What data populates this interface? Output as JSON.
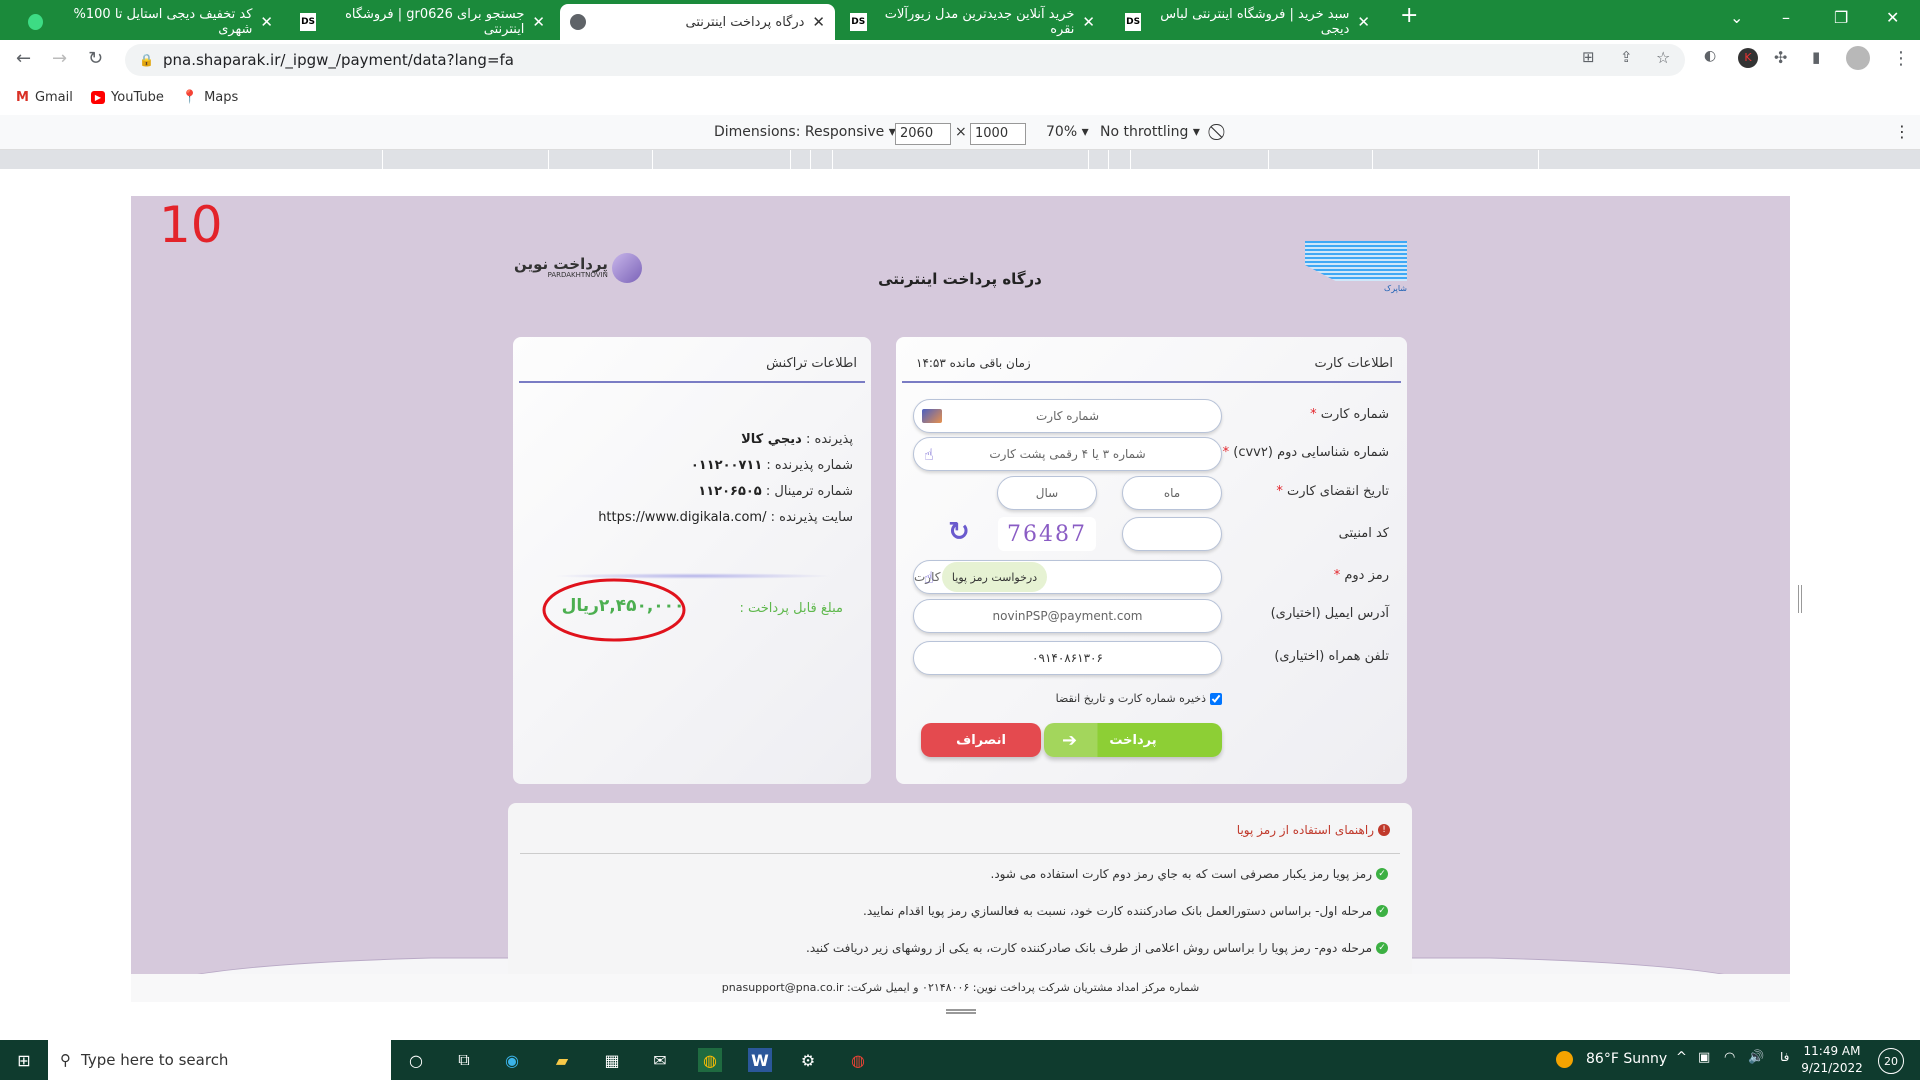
{
  "browser": {
    "tabs": [
      {
        "title": "کد تخفیف دیجی استایل تا 100% شهری",
        "active": false
      },
      {
        "title": "جستجو برای gr0626 | فروشگاه اینترنتی",
        "active": false,
        "favicon": "DS"
      },
      {
        "title": "درگاه پرداخت اینترنتی",
        "active": true
      },
      {
        "title": "خرید آنلاین جدیدترین مدل زیورآلات نقره",
        "active": false,
        "favicon": "DS"
      },
      {
        "title": "سبد خرید | فروشگاه اینترنتی لباس دیجی",
        "active": false,
        "favicon": "DS"
      }
    ],
    "url": "pna.shaparak.ir/_ipgw_/payment/data?lang=fa",
    "bookmarks": [
      "Gmail",
      "YouTube",
      "Maps"
    ],
    "accent": "#1b8a3b"
  },
  "devtools": {
    "dimensions": "Dimensions: Responsive",
    "width": "2060",
    "times": "×",
    "height": "1000",
    "zoom": "70%",
    "throttling": "No throttling"
  },
  "annotation": {
    "number": "10"
  },
  "header": {
    "title": "درگاه پرداخت اینترنتی",
    "logo_left": "پرداخت نوین PARDAKHTNOVIN",
    "logo_right": "شاپرک"
  },
  "card_form": {
    "title": "اطلاعات کارت",
    "timer": "زمان باقی مانده ۱۴:۵۳",
    "labels": {
      "card_number": "شماره کارت",
      "cvv2": "شماره شناسایی دوم (cvv۲)",
      "expiry": "تاریخ انقضای کارت",
      "captcha": "کد امنیتی",
      "pin2": "رمز دوم",
      "email": "آدرس ایمیل (اختیاری)",
      "phone": "تلفن همراه (اختیاری)"
    },
    "placeholders": {
      "card_number": "شماره کارت",
      "cvv2": "شماره ۳ یا ۴ رقمی پشت کارت",
      "month": "ماه",
      "year": "سال",
      "pin2": "رمز دوم کارت"
    },
    "values": {
      "email": "novinPSP@payment.com",
      "phone": "۰۹۱۴۰۸۶۱۳۰۶",
      "captcha_image": "76487"
    },
    "dynamic_pin_button": "درخواست رمز پویا",
    "save_checkbox": "ذخیره شماره کارت و تاریخ انقضا",
    "save_checked": true,
    "pay_button": "پرداخت",
    "cancel_button": "انصراف",
    "required": "*"
  },
  "transaction": {
    "title": "اطلاعات تراکنش",
    "rows": [
      {
        "label": "پذیرنده  :",
        "value": "ديجي كالا"
      },
      {
        "label": "شماره پذیرنده  :",
        "value": "۰۱۱۲۰۰۷۱۱"
      },
      {
        "label": "شماره ترمینال  :",
        "value": "۱۱۲۰۶۵۰۵"
      },
      {
        "label": "سایت پذیرنده  :",
        "value": "https://www.digikala.com/"
      }
    ],
    "amount_label": "مبلغ قابل پرداخت :",
    "amount": "۲,۴۵۰,۰۰۰ریال"
  },
  "guide": {
    "title": "راهنمای استفاده از رمز پویا",
    "items": [
      "رمز پویا رمز یکبار مصرفی است که به جاي رمز دوم کارت استفاده می شود.",
      "مرحله اول- براساس دستورالعمل بانک صادرکننده کارت خود، نسبت به فعالسازي رمز پويا اقدام نماييد.",
      "مرحله دوم- رمز پویا را براساس روش اعلامی از طرف بانک صادرکننده کارت، به یکی از روشهای زیر دریافت کنید."
    ]
  },
  "footer": {
    "text": "شماره مرکز امداد مشتریان شرکت پرداخت نوین: ۰۲۱۴۸۰۰۶ و ایمیل شرکت: pnasupport@pna.co.ir"
  },
  "taskbar": {
    "search_placeholder": "Type here to search",
    "weather": "86°F  Sunny",
    "lang": "فا",
    "time": "11:49 AM",
    "date": "9/21/2022",
    "notifications": "20"
  }
}
